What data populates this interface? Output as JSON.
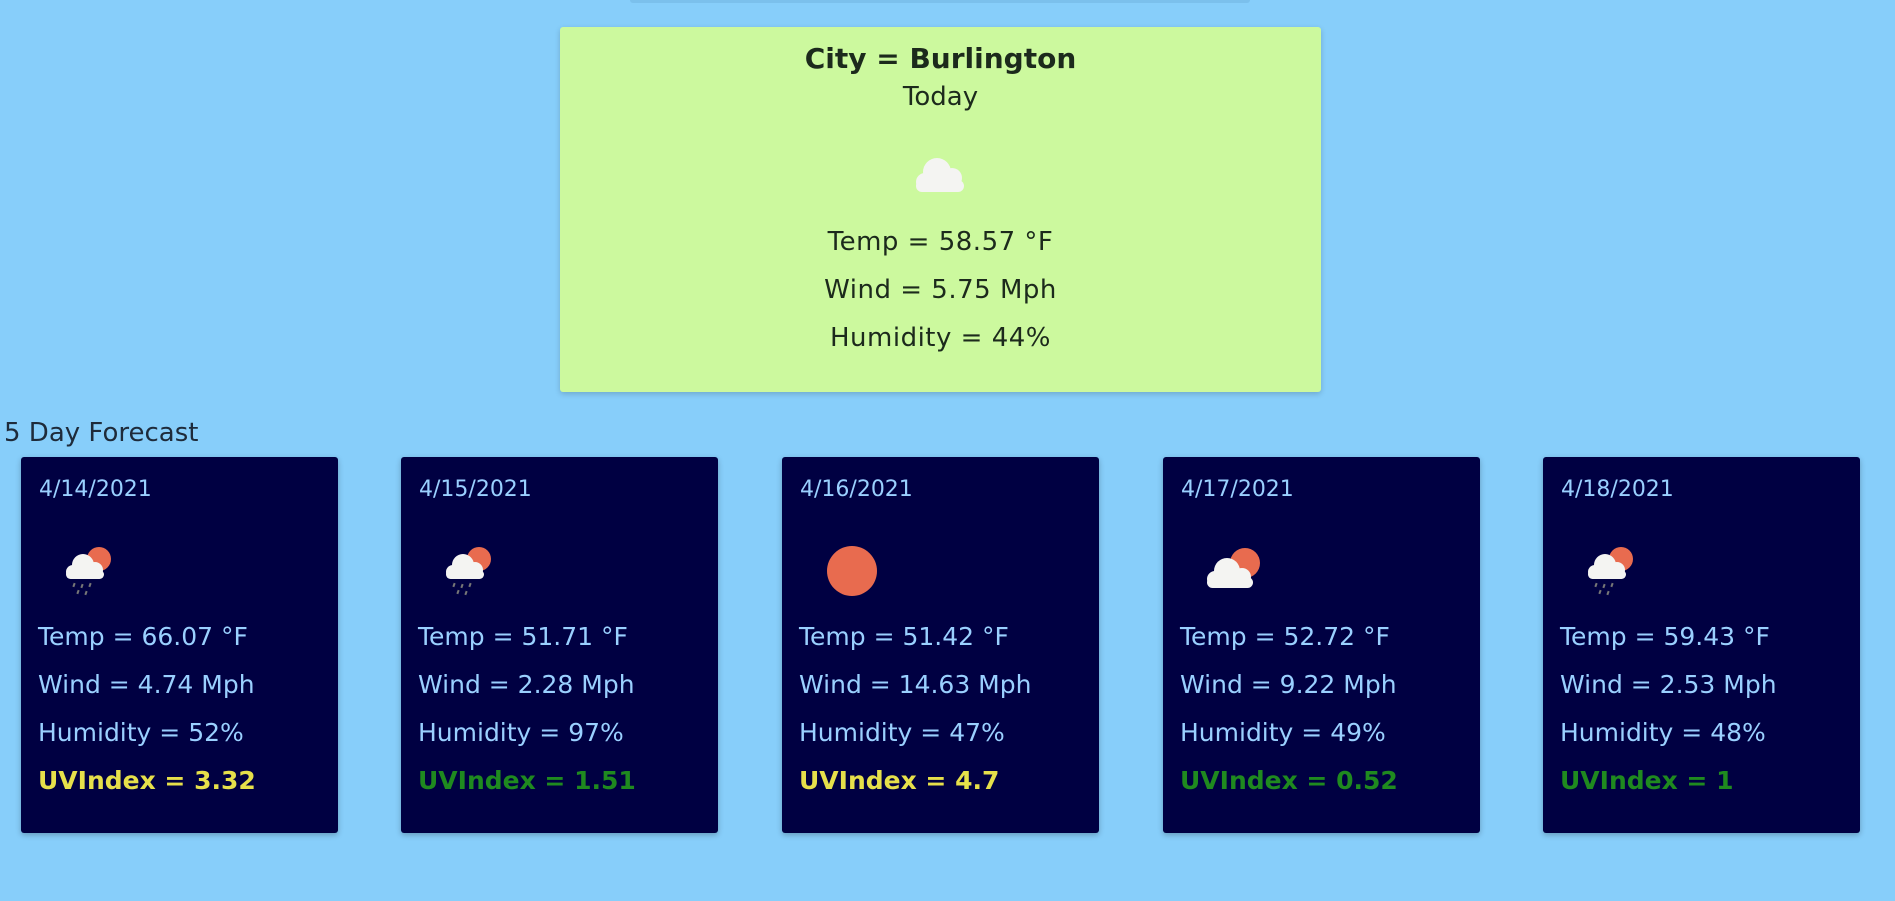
{
  "today": {
    "city": "City = Burlington",
    "label": "Today",
    "icon": "cloud-icon",
    "temp": "Temp = 58.57 °F",
    "wind": "Wind = 5.75 Mph",
    "humidity": "Humidity = 44%"
  },
  "forecast": {
    "title": "5 Day Forecast",
    "days": [
      {
        "date": "4/14/2021",
        "icon": "rain-sun-icon",
        "temp": "Temp = 66.07 °F",
        "wind": "Wind = 4.74 Mph",
        "humidity": "Humidity = 52%",
        "uv": "UVIndex = 3.32",
        "uv_color": "#e6e04a"
      },
      {
        "date": "4/15/2021",
        "icon": "rain-sun-icon",
        "temp": "Temp = 51.71 °F",
        "wind": "Wind = 2.28 Mph",
        "humidity": "Humidity = 97%",
        "uv": "UVIndex = 1.51",
        "uv_color": "#1f8a1f"
      },
      {
        "date": "4/16/2021",
        "icon": "sun-icon",
        "temp": "Temp = 51.42 °F",
        "wind": "Wind = 14.63 Mph",
        "humidity": "Humidity = 47%",
        "uv": "UVIndex = 4.7",
        "uv_color": "#e6e04a"
      },
      {
        "date": "4/17/2021",
        "icon": "cloud-sun-icon",
        "temp": "Temp = 52.72 °F",
        "wind": "Wind = 9.22 Mph",
        "humidity": "Humidity = 49%",
        "uv": "UVIndex = 0.52",
        "uv_color": "#1f8a1f"
      },
      {
        "date": "4/18/2021",
        "icon": "rain-sun-icon",
        "temp": "Temp = 59.43 °F",
        "wind": "Wind = 2.53 Mph",
        "humidity": "Humidity = 48%",
        "uv": "UVIndex = 1",
        "uv_color": "#1f8a1f"
      }
    ]
  },
  "colors": {
    "background": "#87cefa",
    "today_card": "#ccf99e",
    "forecast_card": "#000042",
    "forecast_text": "#9ad0ff",
    "uv_high": "#e6e04a",
    "uv_low": "#1f8a1f"
  }
}
